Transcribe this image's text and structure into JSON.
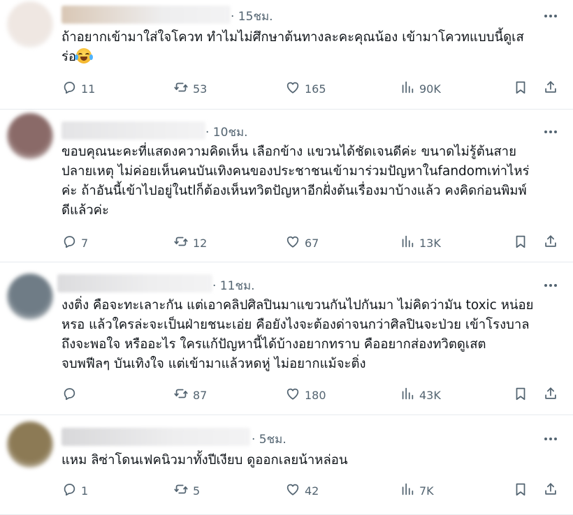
{
  "posts": [
    {
      "time": "· 15ชม.",
      "lines": [
        "ถ้าอยากเข้ามาใส่ใจโควท ทำไมไม่ศึกษาต้นทางละคะคุณน้อง เข้ามาโควทแบบนี้ดูเส",
        "ร่อ"
      ],
      "emoji": "face-with-tears-of-joy",
      "replies": "11",
      "reposts": "53",
      "likes": "165",
      "views": "90K",
      "avatar_color": "#efe7e2",
      "name_color": "#d9c7b5"
    },
    {
      "time": "· 10ชม.",
      "lines": [
        "ขอบคุณนะคะที่แสดงความคิดเห็น เลือกข้าง แขวนได้ชัดเจนดีค่ะ ขนาดไม่รู้ต้นสาย",
        "ปลายเหตุ ไม่ค่อยเห็นคนบันเทิงคนของประชาชนเข้ามาร่วมปัญหาในfandomเท่าไหร่",
        "ค่ะ ถ้าอันนี้เข้าไปอยู่ในtlก็ต้องเห็นทวิตปัญหาอีกฝั่งต้นเรื่องมาบ้างแล้ว คงคิดก่อนพิมพ์",
        "ดีแล้วค่ะ"
      ],
      "replies": "7",
      "reposts": "12",
      "likes": "67",
      "views": "13K",
      "avatar_color": "#8a6a68",
      "name_color": "#e4e4e6"
    },
    {
      "time": "· 11ชม.",
      "lines": [
        "งงติ่ง คือจะทะเลาะกัน แต่เอาคลิปศิลปินมาแขวนกันไปกันมา ไม่คิดว่ามัน toxic หน่อย",
        "หรอ แล้วใครล่ะจะเป็นฝ่ายชนะเอ่ย คือยังไงจะต้องด่าจนกว่าศิลปินจะป่วย เข้าโรงบาล",
        "ถึงจะพอใจ หรืออะไร ใครแก้ปัญหานี้ได้บ้างอยากทราบ คืออยากส่องทวิตดูเสต",
        "จบพฟีลๆ บันเทิงใจ แต่เข้ามาแล้วหดหู่ ไม่อยากแม้จะติ่ง"
      ],
      "replies": "",
      "reposts": "87",
      "likes": "180",
      "views": "43K",
      "avatar_color": "#6f7c86",
      "name_color": "#dcdcde"
    },
    {
      "time": "· 5ชม.",
      "lines": [
        "แหม ลิซ่าโดนเฟคนิวมาทั้งปีเงียบ ดูออกเลยน้าหล่อน"
      ],
      "replies": "1",
      "reposts": "5",
      "likes": "42",
      "views": "7K",
      "avatar_color": "#8c7a55",
      "name_color": "#d8d8da"
    }
  ],
  "icons": {
    "reply": "reply-icon",
    "repost": "repost-icon",
    "like": "like-icon",
    "views": "views-icon",
    "bookmark": "bookmark-icon",
    "share": "share-icon",
    "more": "more-icon"
  },
  "colors": {
    "text": "#0f1419",
    "muted": "#536471",
    "divider": "#e6eaee"
  }
}
